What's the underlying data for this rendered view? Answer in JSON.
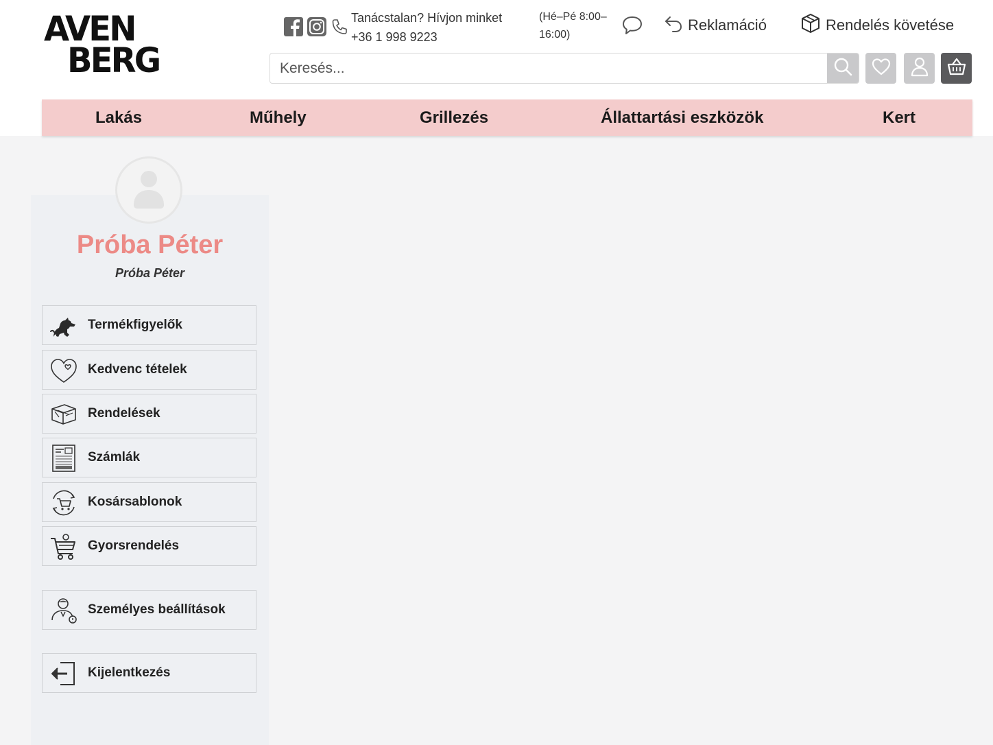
{
  "brand": {
    "logo_line1": "AVEN",
    "logo_line2": "BERG"
  },
  "contact": {
    "line1": "Tanácstalan? Hívjon minket",
    "line2": "+36 1 998 9223",
    "hours_line1": "(Hé–Pé 8:00–",
    "hours_line2": "16:00)"
  },
  "header_links": {
    "reklamacio": "Reklamáció",
    "tracking": "Rendelés követése"
  },
  "search": {
    "placeholder": "Keresés..."
  },
  "nav": [
    {
      "label": "Lakás"
    },
    {
      "label": "Műhely"
    },
    {
      "label": "Grillezés"
    },
    {
      "label": "Állattartási eszközök"
    },
    {
      "label": "Kert"
    }
  ],
  "profile": {
    "name": "Próba Péter",
    "subtitle": "Próba Péter"
  },
  "menu": [
    {
      "label": "Termékfigyelők",
      "icon": "dog-icon"
    },
    {
      "label": "Kedvenc tételek",
      "icon": "heart-icon"
    },
    {
      "label": "Rendelések",
      "icon": "boxes-icon"
    },
    {
      "label": "Számlák",
      "icon": "invoice-icon"
    },
    {
      "label": "Kosársablonok",
      "icon": "cart-template-icon"
    },
    {
      "label": "Gyorsrendelés",
      "icon": "quick-cart-icon"
    },
    {
      "label": "Személyes beállítások",
      "icon": "user-settings-icon"
    },
    {
      "label": "Kijelentkezés",
      "icon": "logout-icon"
    }
  ],
  "colors": {
    "accent": "#ec8a86",
    "nav_bg": "#f4cccc",
    "sidebar_bg": "#eef0f3",
    "page_bg": "#f4f4f5",
    "cart_button": "#5a5a5c"
  }
}
